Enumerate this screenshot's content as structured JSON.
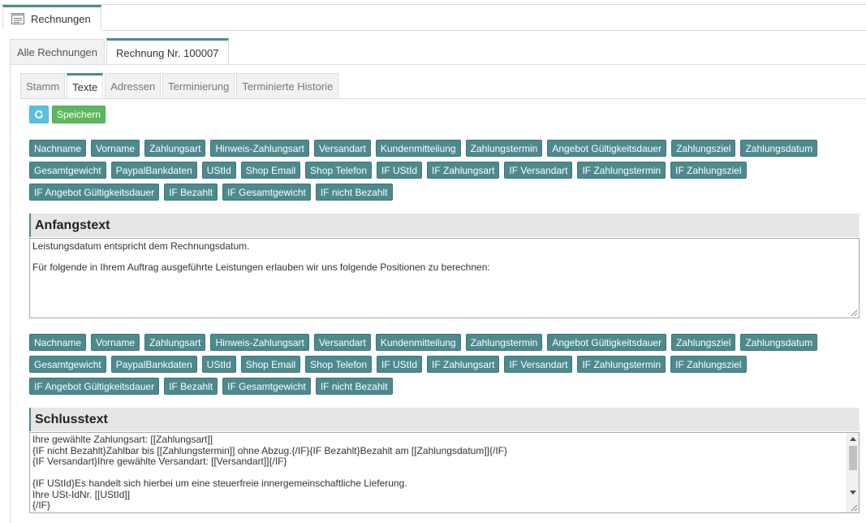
{
  "window_tab": {
    "label": "Rechnungen"
  },
  "main_tabs": [
    {
      "label": "Alle Rechnungen"
    },
    {
      "label": "Rechnung Nr. 100007"
    }
  ],
  "sub_tabs": [
    {
      "label": "Stamm"
    },
    {
      "label": "Texte"
    },
    {
      "label": "Adressen"
    },
    {
      "label": "Terminierung"
    },
    {
      "label": "Terminierte Historie"
    }
  ],
  "toolbar": {
    "save_label": "Speichern"
  },
  "placeholders": [
    "Nachname",
    "Vorname",
    "Zahlungsart",
    "Hinweis-Zahlungsart",
    "Versandart",
    "Kundenmitteilung",
    "Zahlungstermin",
    "Angebot Gültigkeitsdauer",
    "Zahlungsziel",
    "Zahlungsdatum",
    "Gesamtgewicht",
    "PaypalBankdaten",
    "UStId",
    "Shop Email",
    "Shop Telefon",
    "IF UStId",
    "IF Zahlungsart",
    "IF Versandart",
    "IF Zahlungstermin",
    "IF Zahlungsziel",
    "IF Angebot Gültigkeitsdauer",
    "IF Bezahlt",
    "IF Gesamtgewicht",
    "IF nicht Bezahlt"
  ],
  "anfangstext": {
    "heading": "Anfangstext",
    "lines": [
      "Leistungsdatum entspricht dem Rechnungsdatum.",
      "Für folgende in Ihrem Auftrag ausgeführte Leistungen erlauben wir uns folgende Positionen zu berechnen:"
    ]
  },
  "schlusstext": {
    "heading": "Schlusstext",
    "lines": [
      "Ihre gewählte Zahlungsart: [[Zahlungsart]]",
      "{IF nicht Bezahlt}Zahlbar bis [[Zahlungstermin]] ohne Abzug.{/IF}{IF Bezahlt}Bezahlt am [[Zahlungsdatum]]{/IF}",
      "{IF Versandart}Ihre gewählte Versandart: [[Versandart]]{/IF}",
      "",
      "{IF UStId}Es handelt sich hierbei um eine steuerfreie innergemeinschaftliche Lieferung.",
      "Ihre USt-IdNr. [[UStId]]",
      "{/IF}"
    ]
  },
  "colors": {
    "accent": "#4d8a8e",
    "refresh": "#5bc0de",
    "save": "#5cb85c"
  }
}
